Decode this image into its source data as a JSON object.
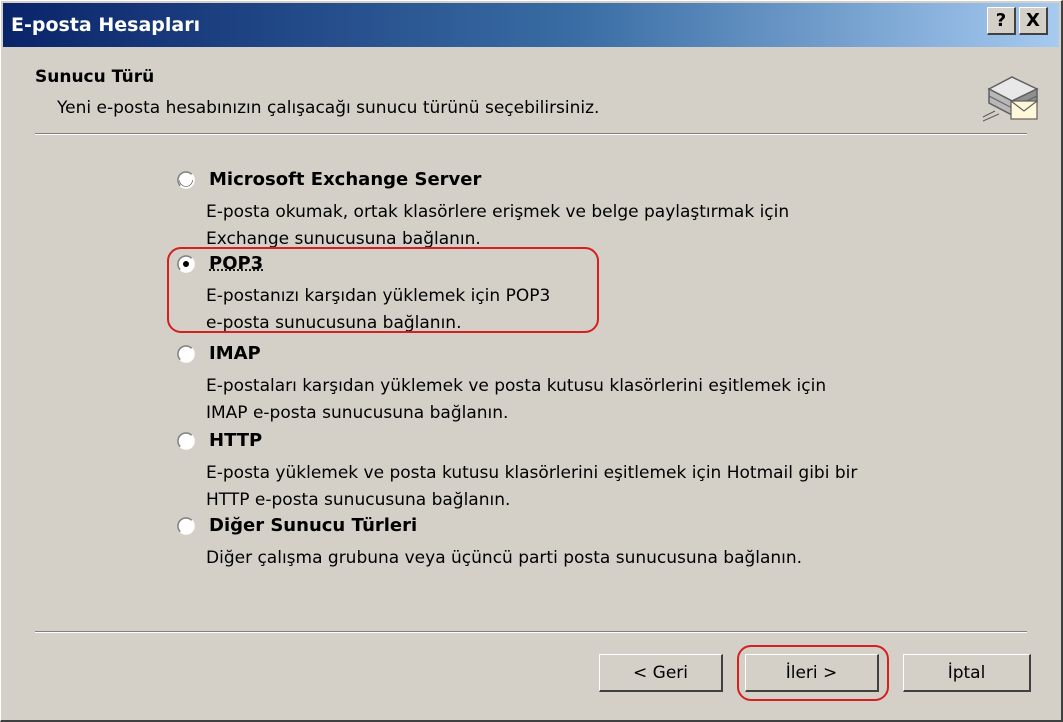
{
  "window": {
    "title": "E-posta Hesapları",
    "help_button": "?",
    "close_button": "X"
  },
  "header": {
    "title": "Sunucu Türü",
    "description": "Yeni e-posta hesabınızın çalışacağı sunucu türünü seçebilirsiniz.",
    "icon": "mail-server-icon"
  },
  "options": [
    {
      "label": "Microsoft Exchange Server",
      "desc1": "E-posta okumak, ortak klasörlere erişmek ve belge paylaştırmak için",
      "desc2": "Exchange sunucusuna bağlanın.",
      "selected": false
    },
    {
      "label": "POP3",
      "desc1": "E-postanızı karşıdan yüklemek için POP3",
      "desc2": "e-posta sunucusuna bağlanın.",
      "selected": true
    },
    {
      "label": "IMAP",
      "desc1": "E-postaları karşıdan yüklemek ve posta kutusu klasörlerini eşitlemek için",
      "desc2": "IMAP e-posta sunucusuna bağlanın.",
      "selected": false
    },
    {
      "label": "HTTP",
      "desc1": "E-posta yüklemek ve posta kutusu klasörlerini eşitlemek için Hotmail gibi bir",
      "desc2": "HTTP e-posta sunucusuna bağlanın.",
      "selected": false
    },
    {
      "label": "Diğer Sunucu Türleri",
      "desc1": "Diğer çalışma grubuna veya üçüncü parti posta sunucusuna bağlanın.",
      "desc2": "",
      "selected": false
    }
  ],
  "buttons": {
    "back": "< Geri",
    "next": "İleri >",
    "cancel": "İptal"
  },
  "colors": {
    "titlebar_start": "#0a246a",
    "titlebar_end": "#a6caf0",
    "dialog_bg": "#d4d0c8",
    "annotation_red": "#d42020"
  }
}
